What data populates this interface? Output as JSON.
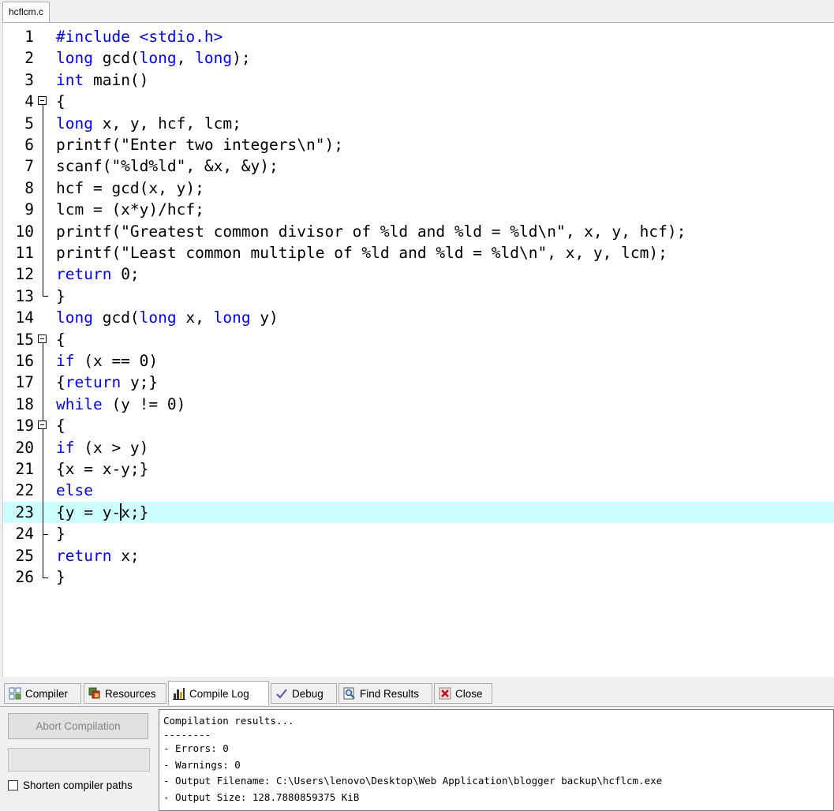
{
  "file_tab": {
    "label": "hcflcm.c"
  },
  "editor": {
    "active_line": 23,
    "lines": [
      {
        "num": "1",
        "tokens": [
          {
            "t": "#include <stdio.h>",
            "kw": true
          }
        ]
      },
      {
        "num": "2",
        "tokens": [
          {
            "t": "long",
            "kw": true
          },
          {
            "t": " gcd("
          },
          {
            "t": "long",
            "kw": true
          },
          {
            "t": ", "
          },
          {
            "t": "long",
            "kw": true
          },
          {
            "t": ");"
          }
        ]
      },
      {
        "num": "3",
        "tokens": [
          {
            "t": "int",
            "kw": true
          },
          {
            "t": " main()"
          }
        ]
      },
      {
        "num": "4",
        "tokens": [
          {
            "t": "{"
          }
        ]
      },
      {
        "num": "5",
        "tokens": [
          {
            "t": "long",
            "kw": true
          },
          {
            "t": " x, y, hcf, lcm;"
          }
        ]
      },
      {
        "num": "6",
        "tokens": [
          {
            "t": "printf(\"Enter two integers\\n\");"
          }
        ]
      },
      {
        "num": "7",
        "tokens": [
          {
            "t": "scanf(\"%ld%ld\", &x, &y);"
          }
        ]
      },
      {
        "num": "8",
        "tokens": [
          {
            "t": "hcf = gcd(x, y);"
          }
        ]
      },
      {
        "num": "9",
        "tokens": [
          {
            "t": "lcm = (x*y)/hcf;"
          }
        ]
      },
      {
        "num": "10",
        "tokens": [
          {
            "t": "printf(\"Greatest common divisor of %ld and %ld = %ld\\n\", x, y, hcf);"
          }
        ]
      },
      {
        "num": "11",
        "tokens": [
          {
            "t": "printf(\"Least common multiple of %ld and %ld = %ld\\n\", x, y, lcm);"
          }
        ]
      },
      {
        "num": "12",
        "tokens": [
          {
            "t": "return",
            "kw": true
          },
          {
            "t": " 0;"
          }
        ]
      },
      {
        "num": "13",
        "tokens": [
          {
            "t": "}"
          }
        ]
      },
      {
        "num": "14",
        "tokens": [
          {
            "t": "long",
            "kw": true
          },
          {
            "t": " gcd("
          },
          {
            "t": "long",
            "kw": true
          },
          {
            "t": " x, "
          },
          {
            "t": "long",
            "kw": true
          },
          {
            "t": " y)"
          }
        ]
      },
      {
        "num": "15",
        "tokens": [
          {
            "t": "{"
          }
        ]
      },
      {
        "num": "16",
        "tokens": [
          {
            "t": "if",
            "kw": true
          },
          {
            "t": " (x == 0)"
          }
        ]
      },
      {
        "num": "17",
        "tokens": [
          {
            "t": "{"
          },
          {
            "t": "return",
            "kw": true
          },
          {
            "t": " y;}"
          }
        ]
      },
      {
        "num": "18",
        "tokens": [
          {
            "t": "while",
            "kw": true
          },
          {
            "t": " (y != 0)"
          }
        ]
      },
      {
        "num": "19",
        "tokens": [
          {
            "t": "{"
          }
        ]
      },
      {
        "num": "20",
        "tokens": [
          {
            "t": "if",
            "kw": true
          },
          {
            "t": " (x > y)"
          }
        ]
      },
      {
        "num": "21",
        "tokens": [
          {
            "t": "{x = x-y;}"
          }
        ]
      },
      {
        "num": "22",
        "tokens": [
          {
            "t": "else",
            "kw": true
          }
        ]
      },
      {
        "num": "23",
        "tokens": [
          {
            "t": "{y = y-"
          },
          {
            "caret": true
          },
          {
            "t": "x;}"
          }
        ]
      },
      {
        "num": "24",
        "tokens": [
          {
            "t": "}"
          }
        ]
      },
      {
        "num": "25",
        "tokens": [
          {
            "t": "return",
            "kw": true
          },
          {
            "t": " x;"
          }
        ]
      },
      {
        "num": "26",
        "tokens": [
          {
            "t": "}"
          }
        ]
      }
    ],
    "fold_markers": {
      "4": "open",
      "5": "line",
      "6": "line",
      "7": "line",
      "8": "line",
      "9": "line",
      "10": "line",
      "11": "line",
      "12": "line",
      "13": "end",
      "15": "open",
      "16": "line",
      "17": "line",
      "18": "line",
      "19": "open-nested",
      "20": "line",
      "21": "line",
      "22": "line",
      "23": "line",
      "24": "mid-end",
      "25": "line",
      "26": "end"
    }
  },
  "panel_tabs": [
    {
      "label": "Compiler",
      "icon": "grid-icon",
      "active": false
    },
    {
      "label": "Resources",
      "icon": "resources-icon",
      "active": false
    },
    {
      "label": "Compile Log",
      "icon": "bar-chart-icon",
      "active": true
    },
    {
      "label": "Debug",
      "icon": "checkmark-icon",
      "active": false
    },
    {
      "label": "Find Results",
      "icon": "magnifier-icon",
      "active": false
    },
    {
      "label": "Close",
      "icon": "close-icon",
      "active": false
    }
  ],
  "panel": {
    "abort_button": "Abort Compilation",
    "shorten_paths_label": "Shorten compiler paths",
    "log_lines": [
      "Compilation results...",
      "--------",
      "- Errors: 0",
      "- Warnings: 0",
      "- Output Filename: C:\\Users\\lenovo\\Desktop\\Web Application\\blogger backup\\hcflcm.exe",
      "- Output Size: 128.7880859375 KiB"
    ]
  },
  "colors": {
    "keyword": "#0000ff",
    "active_line_bg": "#ccffff"
  }
}
